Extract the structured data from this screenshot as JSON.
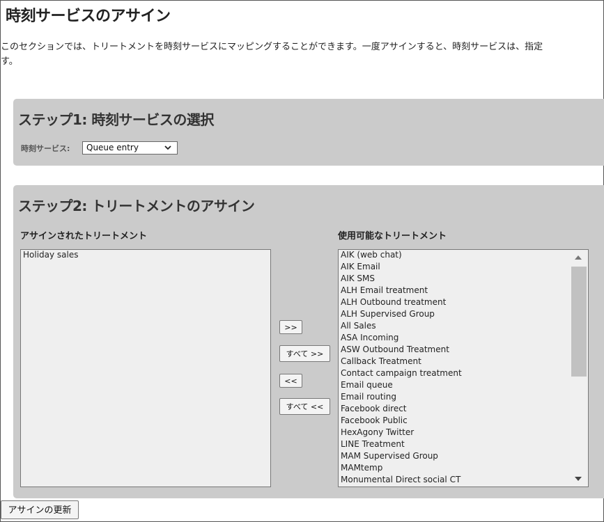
{
  "page": {
    "title": "時刻サービスのアサイン",
    "intro_line1": "このセクションでは、トリートメントを時刻サービスにマッピングすることができます。一度アサインすると、時刻サービスは、指定",
    "intro_line2": "す。"
  },
  "step1": {
    "title": "ステップ1: 時刻サービスの選択",
    "field_label": "時刻サービス:",
    "selected_value": "Queue entry"
  },
  "step2": {
    "title": "ステップ2: トリートメントのアサイン",
    "assigned_label": "アサインされたトリートメント",
    "available_label": "使用可能なトリートメント",
    "assigned_items": [
      "Holiday sales"
    ],
    "available_items": [
      "AIK (web chat)",
      "AIK Email",
      "AIK SMS",
      "ALH Email treatment",
      "ALH Outbound treatment",
      "ALH Supervised Group",
      "All Sales",
      "ASA Incoming",
      "ASW Outbound Treatment",
      "Callback Treatment",
      "Contact campaign treatment",
      "Email queue",
      "Email routing",
      "Facebook direct",
      "Facebook Public",
      "HexAgony Twitter",
      "LINE Treatment",
      "MAM Supervised Group",
      "MAMtemp",
      "Monumental Direct social CT"
    ],
    "buttons": {
      "add": ">>",
      "add_all": "すべて >>",
      "remove": "<<",
      "remove_all": "すべて <<"
    }
  },
  "footer": {
    "update_button": "アサインの更新"
  },
  "icons": {
    "select_arrow": "chevron-down-icon",
    "scroll_up": "scroll-up-arrow-icon",
    "scroll_down": "scroll-down-arrow-icon"
  }
}
